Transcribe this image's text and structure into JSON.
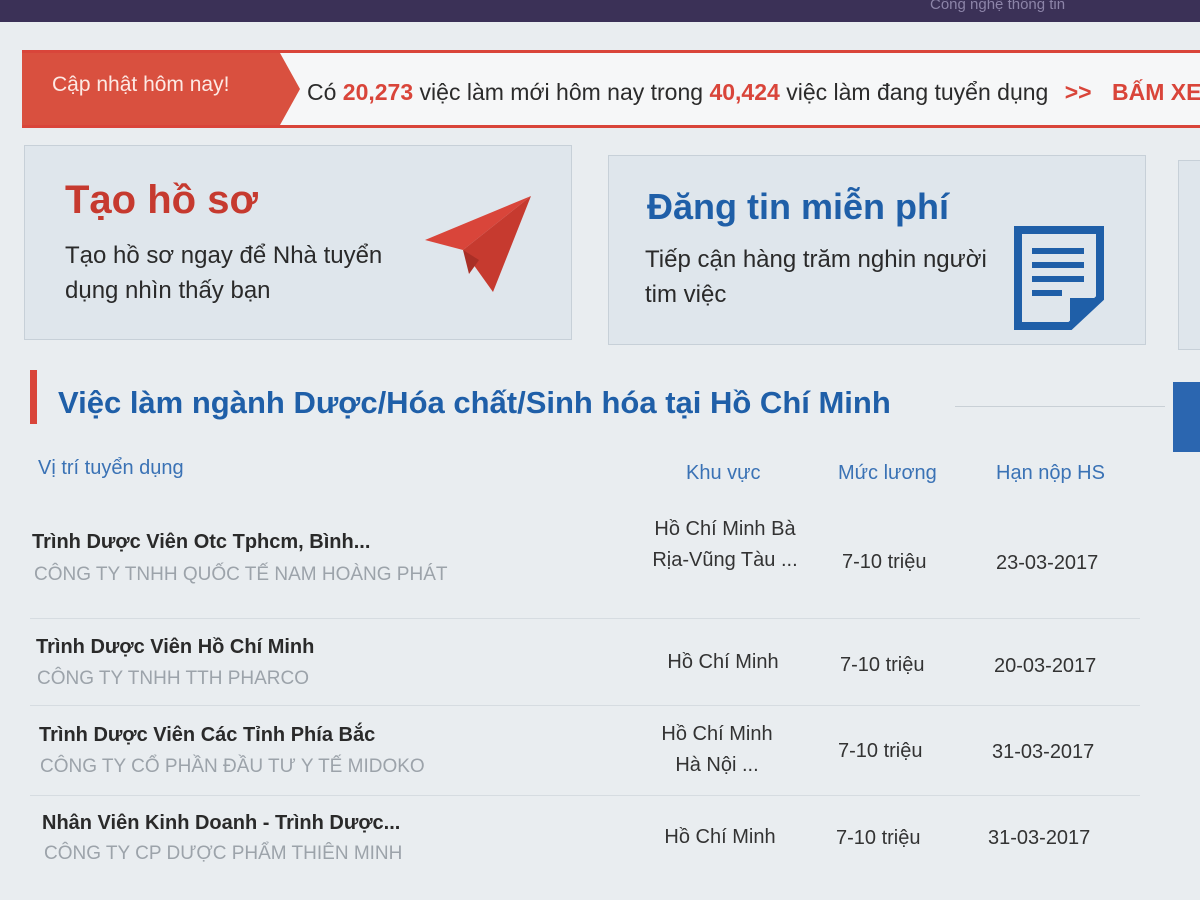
{
  "topbar": {
    "nav_text": "Công nghệ thông tin"
  },
  "update_bar": {
    "tag": "Cập nhật hôm nay!",
    "prefix": "Có",
    "new_jobs": "20,273",
    "middle": "việc làm mới hôm nay trong",
    "total_jobs": "40,424",
    "suffix": "việc làm đang tuyển dụng",
    "arrows": ">>",
    "cta": "BẤM XEM"
  },
  "promos": [
    {
      "title": "Tạo hồ sơ",
      "desc": "Tạo hồ sơ ngay để Nhà tuyển dụng nhìn thấy bạn",
      "icon": "paper-plane-icon",
      "color": "#c63a2f"
    },
    {
      "title": "Đăng tin miễn phí",
      "desc": "Tiếp cận hàng trăm nghin người tim việc",
      "icon": "document-icon",
      "color": "#1f5fa8"
    }
  ],
  "section": {
    "title": "Việc làm ngành Dược/Hóa chất/Sinh hóa tại Hồ Chí Minh"
  },
  "table": {
    "headers": {
      "position": "Vị trí tuyển dụng",
      "region": "Khu vực",
      "salary": "Mức lương",
      "deadline": "Hạn nộp HS"
    },
    "rows": [
      {
        "title": "Trình Dược Viên Otc Tphcm, Bình...",
        "company": "CÔNG TY TNHH QUỐC TẾ NAM HOÀNG PHÁT",
        "location": "Hồ Chí Minh Bà Rịa-Vũng Tàu ...",
        "salary": "7-10 triệu",
        "deadline": "23-03-2017"
      },
      {
        "title": "Trình Dược Viên Hồ Chí Minh",
        "company": "CÔNG TY TNHH TTH PHARCO",
        "location": "Hồ Chí Minh",
        "salary": "7-10 triệu",
        "deadline": "20-03-2017"
      },
      {
        "title": "Trình Dược Viên Các Tỉnh Phía Bắc",
        "company": "CÔNG TY CỔ PHẦN ĐẦU TƯ Y TẾ MIDOKO",
        "location": "Hồ Chí Minh Hà Nội ...",
        "salary": "7-10 triệu",
        "deadline": "31-03-2017"
      },
      {
        "title": "Nhân Viên Kinh Doanh - Trình Dược...",
        "company": "CÔNG TY CP DƯỢC PHẨM THIÊN MINH",
        "location": "Hồ Chí Minh",
        "salary": "7-10 triệu",
        "deadline": "31-03-2017"
      }
    ]
  },
  "colors": {
    "accent_red": "#d9453a",
    "brand_blue": "#1f5fa8",
    "link_blue": "#3a72b5"
  }
}
